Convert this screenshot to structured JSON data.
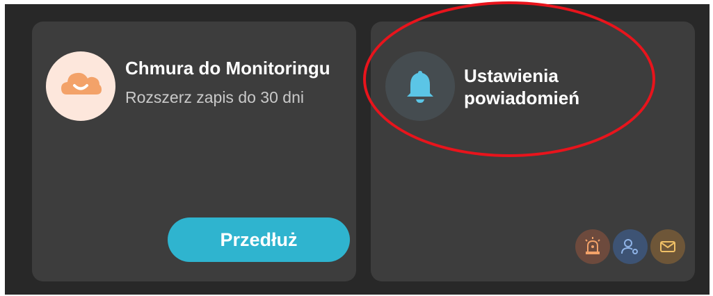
{
  "cards": {
    "cloud": {
      "title": "Chmura do Monitoringu",
      "subtitle": "Rozszerz zapis do 30 dni",
      "button_label": "Przedłuż",
      "icon": "cloud-icon"
    },
    "notifications": {
      "title": "Ustawienia powiadomień",
      "icon": "bell-icon",
      "channels": [
        {
          "icon": "alarm-siren-icon"
        },
        {
          "icon": "user-key-icon"
        },
        {
          "icon": "mail-icon"
        }
      ]
    }
  },
  "colors": {
    "background": "#282828",
    "card": "#3d3d3d",
    "accent": "#2fb4cf",
    "cloud_orange": "#f3a269",
    "bell_blue": "#5bc5e6",
    "annotation_red": "#e8141c"
  }
}
